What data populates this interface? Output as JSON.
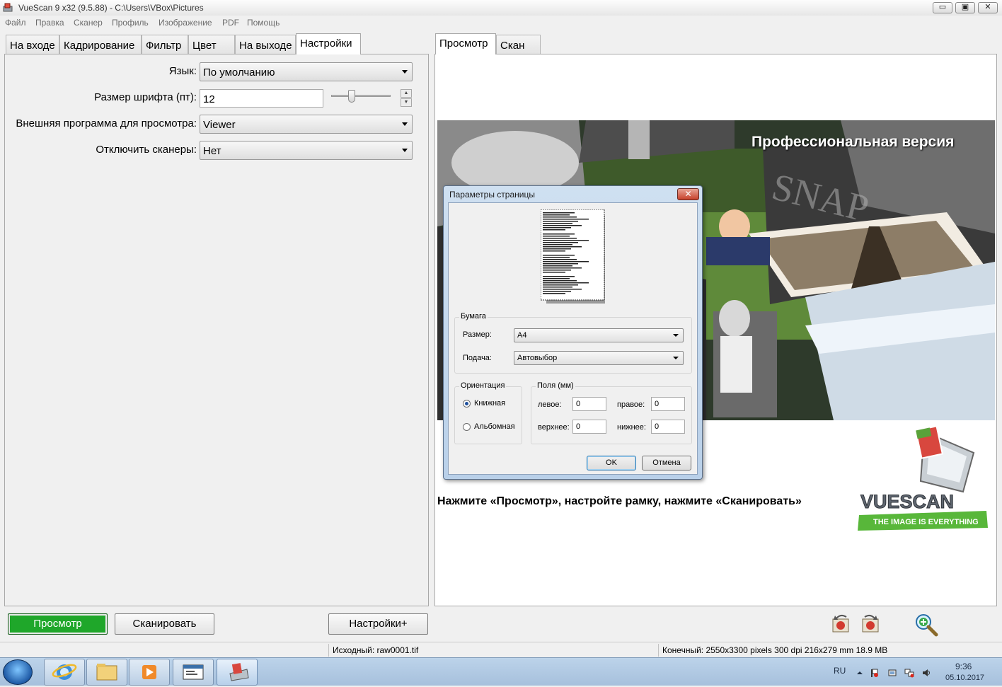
{
  "window": {
    "title": "VueScan 9 x32 (9.5.88) - C:\\Users\\VBox\\Pictures",
    "minimize": "▭",
    "maximize": "▣",
    "close": "✕"
  },
  "menu": [
    "Файл",
    "Правка",
    "Сканер",
    "Профиль",
    "Изображение",
    "PDF",
    "Помощь"
  ],
  "left_tabs": [
    "На входе",
    "Кадрирование",
    "Фильтр",
    "Цвет",
    "На выходе",
    "Настройки"
  ],
  "active_left_tab": "Настройки",
  "settings": {
    "language_label": "Язык:",
    "language_value": "По умолчанию",
    "font_size_label": "Размер шрифта (пт):",
    "font_size_value": "12",
    "viewer_label": "Внешняя программа для просмотра:",
    "viewer_value": "Viewer",
    "disable_scanners_label": "Отключить сканеры:",
    "disable_scanners_value": "Нет"
  },
  "right_tabs": [
    "Просмотр",
    "Скан"
  ],
  "active_right_tab": "Просмотр",
  "preview": {
    "pro_title": "Профессиональная версия",
    "hint": "Нажмите «Просмотр», настройте рамку, нажмите «Сканировать»",
    "logo_text": "VUESCAN",
    "logo_tagline": "THE IMAGE IS EVERYTHING",
    "collage_snap_text": "SNAP"
  },
  "dialog": {
    "title": "Параметры страницы",
    "close": "✕",
    "paper_group": "Бумага",
    "size_label": "Размер:",
    "size_value": "A4",
    "feed_label": "Подача:",
    "feed_value": "Автовыбор",
    "orientation_group": "Ориентация",
    "portrait": "Книжная",
    "landscape": "Альбомная",
    "margins_group": "Поля (мм)",
    "left_label": "левое:",
    "left_value": "0",
    "right_label": "правое:",
    "right_value": "0",
    "top_label": "верхнее:",
    "top_value": "0",
    "bottom_label": "нижнее:",
    "bottom_value": "0",
    "ok": "OK",
    "cancel": "Отмена"
  },
  "buttons": {
    "preview": "Просмотр",
    "scan": "Сканировать",
    "more_settings": "Настройки+"
  },
  "status": {
    "source": "Исходный: raw0001.tif",
    "output": "Конечный: 2550x3300 pixels 300 dpi 216x279 mm 18.9 MB"
  },
  "taskbar": {
    "language": "RU",
    "time": "9:36",
    "date": "05.10.2017"
  },
  "colors": {
    "preview_button": "#1fa72a",
    "dialog_frame": "#b9d0e9",
    "taskbar": "#b0c8e2"
  }
}
